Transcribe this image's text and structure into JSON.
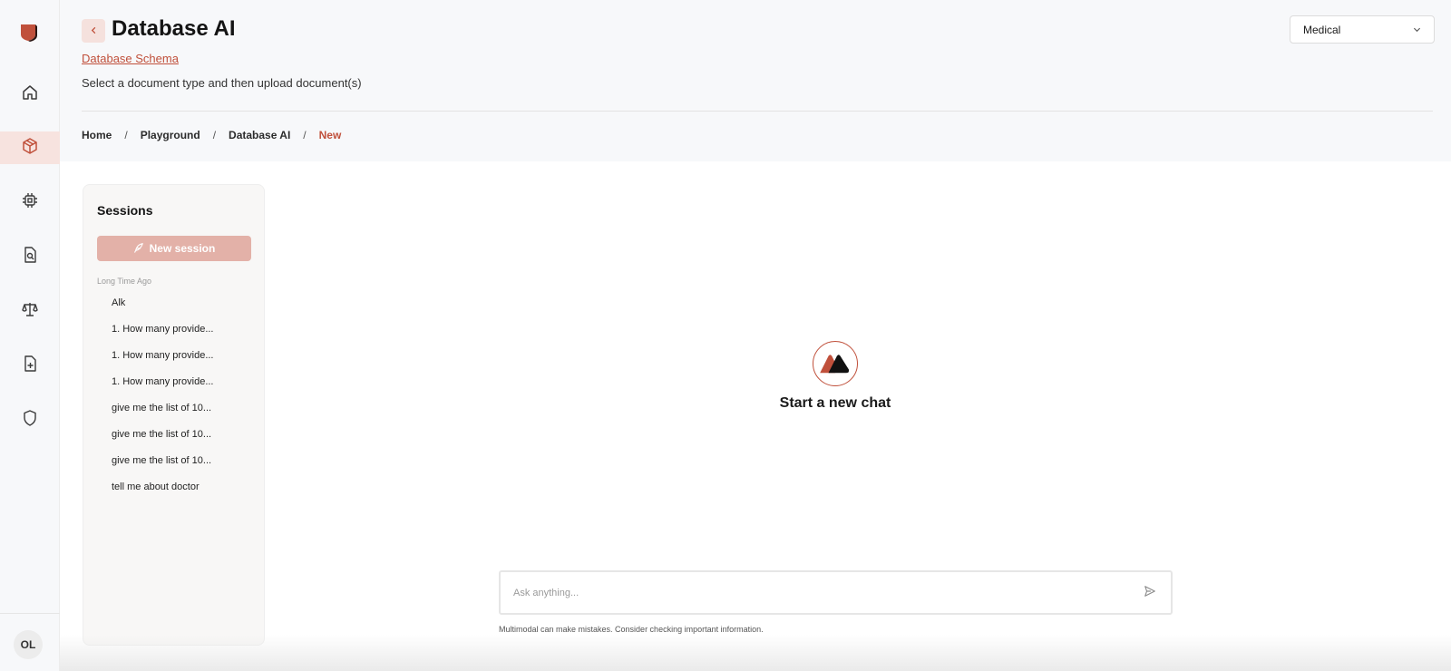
{
  "app": {
    "brand_color": "#c0503b"
  },
  "rail": {
    "items": [
      {
        "icon": "home-icon"
      },
      {
        "icon": "cube-icon",
        "active": true
      },
      {
        "icon": "cpu-icon"
      },
      {
        "icon": "document-search-icon"
      },
      {
        "icon": "scale-icon"
      },
      {
        "icon": "document-add-icon"
      },
      {
        "icon": "shield-icon"
      }
    ],
    "avatar_initials": "OL"
  },
  "header": {
    "title": "Database AI",
    "schema_link": "Database Schema",
    "subtitle": "Select a document type and then upload document(s)",
    "document_type": {
      "selected": "Medical"
    },
    "breadcrumb": [
      {
        "label": "Home"
      },
      {
        "label": "Playground"
      },
      {
        "label": "Database AI"
      },
      {
        "label": "New",
        "current": true
      }
    ]
  },
  "sessions": {
    "title": "Sessions",
    "new_session_label": "New session",
    "group_label": "Long Time Ago",
    "items": [
      "Alk",
      "1. How many provide...",
      "1. How many provide...",
      "1. How many provide...",
      "give me the list of 10...",
      "give me the list of 10...",
      "give me the list of 10...",
      "tell me about doctor"
    ]
  },
  "main": {
    "empty_title": "Start a new chat"
  },
  "composer": {
    "placeholder": "Ask anything...",
    "disclaimer": "Multimodal can make mistakes. Consider checking important information."
  }
}
